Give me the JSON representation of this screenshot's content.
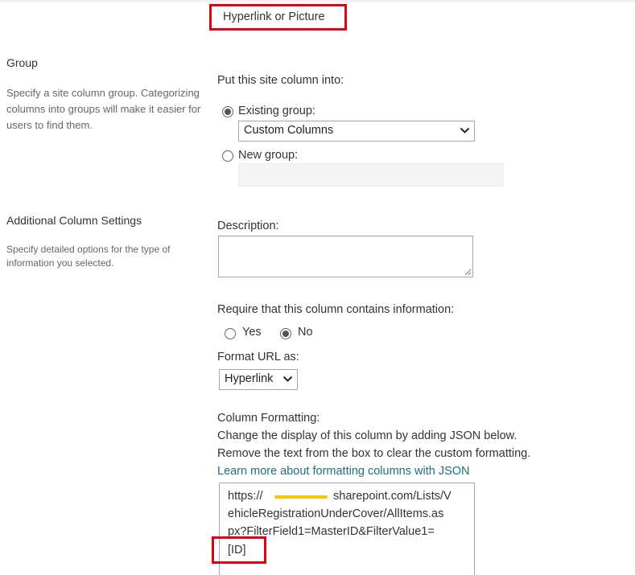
{
  "column_type": {
    "value": "Hyperlink or Picture"
  },
  "group_section": {
    "title": "Group",
    "description": "Specify a site column group. Categorizing columns into groups will make it easier for users to find them.",
    "put_into_label": "Put this site column into:",
    "existing_group_label": "Existing group:",
    "existing_group_selected": true,
    "existing_group_value": "Custom Columns",
    "new_group_label": "New group:",
    "new_group_selected": false,
    "new_group_value": ""
  },
  "additional_section": {
    "title": "Additional Column Settings",
    "description": "Specify detailed options for the type of information you selected.",
    "description_label": "Description:",
    "description_value": "",
    "require_label": "Require that this column contains information:",
    "require_yes_label": "Yes",
    "require_no_label": "No",
    "require_selected": "No",
    "format_url_label": "Format URL as:",
    "format_url_value": "Hyperlink",
    "column_formatting_label": "Column Formatting:",
    "column_formatting_help_1": "Change the display of this column by adding JSON below.",
    "column_formatting_help_2": "Remove the text from the box to clear the custom formatting.",
    "learn_more_link": "Learn more about formatting columns with JSON",
    "json_lines": [
      "https://",
      "sharepoint.com/Lists/V",
      "ehicleRegistrationUnderCover/AllItems.as",
      "px?FilterField1=MasterID&FilterValue1=",
      "[ID]"
    ]
  },
  "colors": {
    "link": "#1e6e80",
    "highlight": "#e00014",
    "redaction": "#f7c600"
  }
}
